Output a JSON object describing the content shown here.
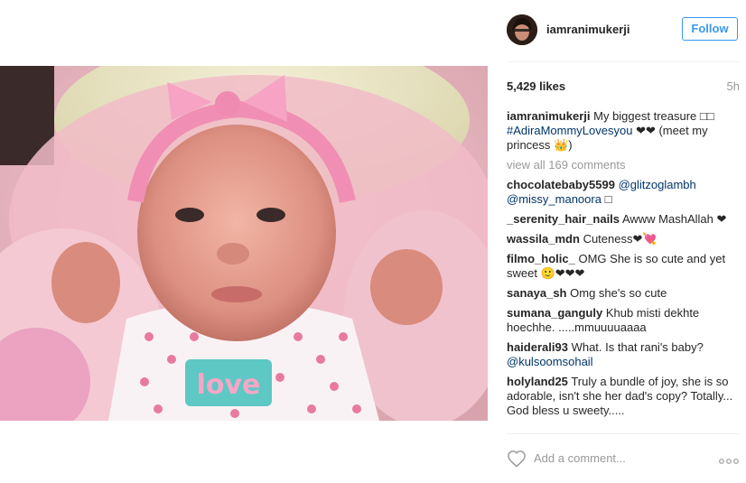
{
  "post": {
    "username": "iamranimukerji",
    "follow_label": "Follow",
    "likes": "5,429 likes",
    "time": "5h",
    "caption": {
      "user": "iamranimukerji",
      "text_1": "My biggest treasure □□ ",
      "tag": "#AdiraMommyLovesyou",
      "text_2": " ❤❤ (meet my princess 👑)"
    },
    "view_all": "view all 169 comments",
    "comments": [
      {
        "user": "chocolatebaby5599",
        "tags": "@glitzoglambh @missy_manoora",
        "text": " □"
      },
      {
        "user": "_serenity_hair_nails",
        "tags": "",
        "text": "Awww MashAllah ❤"
      },
      {
        "user": "wassila_mdn",
        "tags": "",
        "text": "Cuteness❤💘"
      },
      {
        "user": "filmo_holic_",
        "tags": "",
        "text": "OMG She is so cute and yet sweet 🙂❤❤❤"
      },
      {
        "user": "sanaya_sh",
        "tags": "",
        "text": "Omg she's so cute"
      },
      {
        "user": "sumana_ganguly",
        "tags": "",
        "text": "Khub misti dekhte hoechhe. .....mmuuuuaaaa"
      },
      {
        "user": "haiderali93",
        "tags": "@kulsoomsohail",
        "text": "What. Is that rani's baby? "
      },
      {
        "user": "holyland25",
        "tags": "",
        "text": "Truly a bundle of joy, she is so adorable, isn't she her dad's copy? Totally... God bless u sweety....."
      }
    ],
    "add_comment_placeholder": "Add a comment...",
    "photo_label": "love"
  }
}
